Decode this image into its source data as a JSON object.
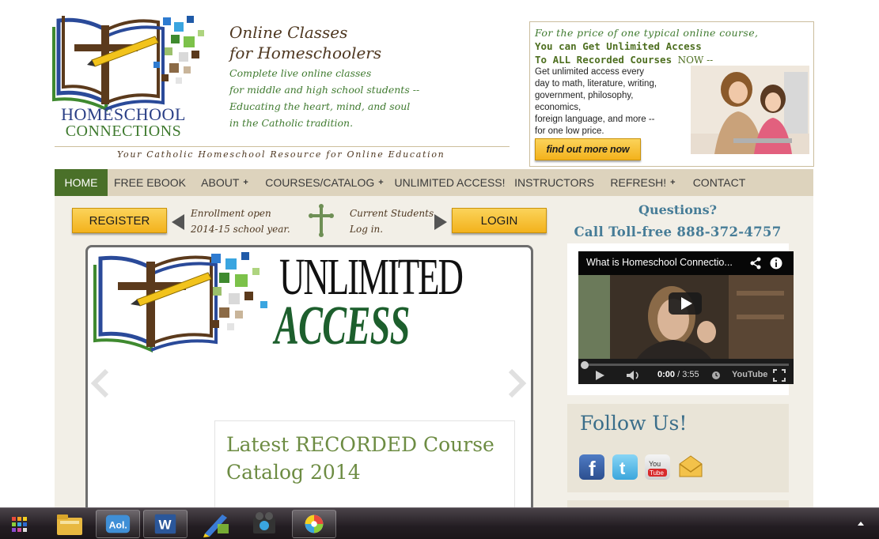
{
  "header": {
    "logo_line1": "HOMESCHOOL",
    "logo_line2": "CONNECTIONS",
    "headline_line1": "Online Classes",
    "headline_line2": "for Homeschoolers",
    "sub_lines": [
      "Complete live online classes",
      "for middle and high school students --",
      "Educating the heart, mind, and soul",
      "in the Catholic tradition."
    ],
    "resource_tagline": "Your Catholic Homeschool Resource for Online Education"
  },
  "promo": {
    "line1": "For the price of one typical online course,",
    "line2": "You can Get Unlimited Access",
    "line3": "To ALL Recorded Courses",
    "now": "NOW --",
    "desc_lines": [
      "Get unlimited access every",
      "day to math, literature, writing,",
      "government, philosophy,",
      "economics,",
      "foreign language, and more --",
      "for one low price."
    ],
    "button_label": "find out more now"
  },
  "nav": {
    "items": [
      {
        "label": "HOME",
        "plus": ""
      },
      {
        "label": "FREE EBOOK",
        "plus": ""
      },
      {
        "label": "ABOUT",
        "plus": "+"
      },
      {
        "label": "COURSES/CATALOG",
        "plus": "+"
      },
      {
        "label": "UNLIMITED ACCESS!",
        "plus": ""
      },
      {
        "label": "INSTRUCTORS",
        "plus": ""
      },
      {
        "label": "REFRESH!",
        "plus": "+"
      },
      {
        "label": "CONTACT",
        "plus": ""
      }
    ]
  },
  "main": {
    "register_label": "REGISTER",
    "enroll_line1": "Enrollment open",
    "enroll_line2": "2014-15 school year.",
    "current_line1": "Current Students",
    "current_line2": "Log in.",
    "login_label": "LOGIN",
    "slider": {
      "ua_word1": "UNLIMITED",
      "ua_word2": "ACCESS",
      "card_title": "Latest RECORDED Course Catalog 2014"
    }
  },
  "sidebar": {
    "questions": "Questions?",
    "tollfree": "Call Toll-free 888-372-4757",
    "video": {
      "title": "What is Homeschool Connectio...",
      "time_current": "0:00",
      "time_total": "/ 3:55",
      "brand": "YouTube"
    },
    "follow_title": "Follow Us!"
  },
  "colors": {
    "nav_active": "#4a7029",
    "nav_bg": "#ddd3bd",
    "accent_green": "#3f7a2f",
    "accent_brown": "#4e3720",
    "accent_blue": "#467c97",
    "button_yellow": "#f3b21c"
  }
}
